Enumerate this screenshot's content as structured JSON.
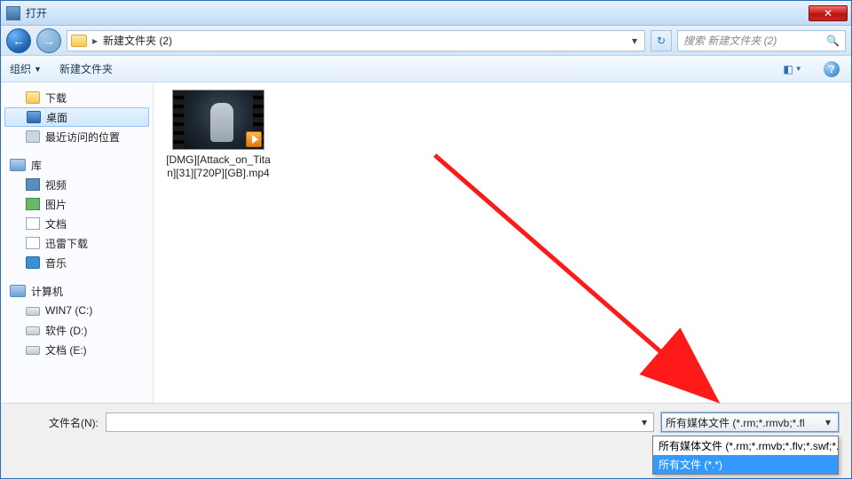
{
  "window": {
    "title": "打开"
  },
  "nav": {
    "path_label": "新建文件夹 (2)",
    "search_placeholder": "搜索 新建文件夹 (2)"
  },
  "toolbar": {
    "organize": "组织",
    "new_folder": "新建文件夹"
  },
  "sidebar": {
    "downloads": "下载",
    "desktop": "桌面",
    "recent": "最近访问的位置",
    "libraries": "库",
    "videos": "视频",
    "pictures": "图片",
    "documents": "文档",
    "xunlei": "迅雷下载",
    "music": "音乐",
    "computer": "计算机",
    "drive_c": "WIN7 (C:)",
    "drive_d": "软件 (D:)",
    "drive_e": "文档 (E:)"
  },
  "content": {
    "file0_name": "[DMG][Attack_on_Titan][31][720P][GB].mp4"
  },
  "footer": {
    "filename_label": "文件名(N):",
    "filter_selected": "所有媒体文件 (*.rm;*.rmvb;*.fl",
    "options": [
      "所有媒体文件 (*.rm;*.rmvb;*.flv;*.swf;*.",
      "所有文件 (*.*)"
    ],
    "selected_index": 1
  }
}
